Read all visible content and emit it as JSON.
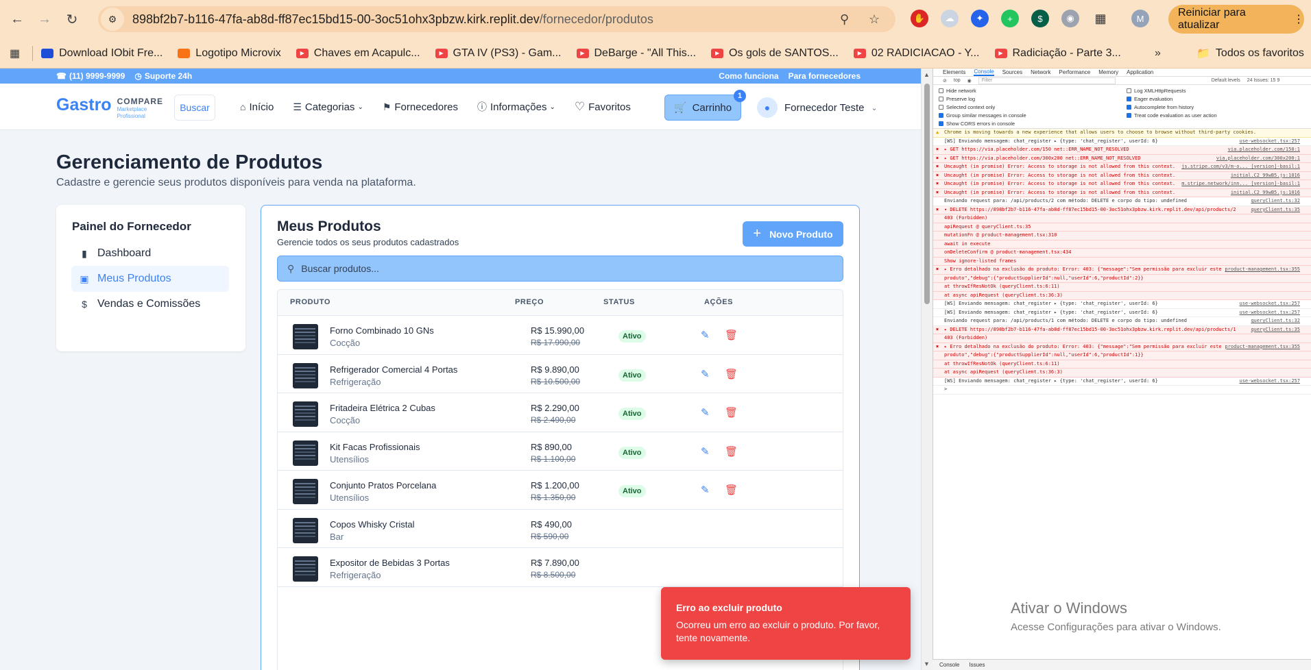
{
  "browser": {
    "url_host": "898bf2b7-b116-47fa-ab8d-ff87ec15bd15-00-3oc51ohx3pbzw.kirk.replit.dev",
    "url_path": "/fornecedor/produtos",
    "update_button": "Reiniciar para atualizar",
    "profile_initial": "M",
    "bookmarks": [
      {
        "label": "Download IObit Fre...",
        "color": "#1d4ed8"
      },
      {
        "label": "Logotipo Microvix",
        "color": "#f97316"
      },
      {
        "label": "Chaves em Acapulc...",
        "color": "#ef4444"
      },
      {
        "label": "GTA IV (PS3) - Gam...",
        "color": "#ef4444"
      },
      {
        "label": "DeBarge - \"All This...",
        "color": "#ef4444"
      },
      {
        "label": "Os gols de SANTOS...",
        "color": "#ef4444"
      },
      {
        "label": "02 RADICIACAO - Y...",
        "color": "#ef4444"
      },
      {
        "label": "Radiciação - Parte 3...",
        "color": "#ef4444"
      }
    ],
    "all_favorites": "Todos os favoritos"
  },
  "topbar": {
    "phone": "(11) 9999-9999",
    "support": "Suporte 24h",
    "how_it_works": "Como funciona",
    "for_suppliers": "Para fornecedores"
  },
  "header": {
    "logo_main": "Gastro",
    "logo_compare": "COMPARE",
    "logo_tag1": "Marketplace",
    "logo_tag2": "Profissional",
    "search_label": "Buscar",
    "nav": {
      "home": "Início",
      "categories": "Categorias",
      "suppliers": "Fornecedores",
      "info": "Informações",
      "favorites": "Favoritos"
    },
    "cart_label": "Carrinho",
    "cart_count": "1",
    "user_name": "Fornecedor Teste"
  },
  "page": {
    "title": "Gerenciamento de Produtos",
    "subtitle": "Cadastre e gerencie seus produtos disponíveis para venda na plataforma."
  },
  "sidebar": {
    "title": "Painel do Fornecedor",
    "items": [
      {
        "label": "Dashboard",
        "icon": "bar-chart-icon"
      },
      {
        "label": "Meus Produtos",
        "icon": "package-icon",
        "active": true
      },
      {
        "label": "Vendas e Comissões",
        "icon": "dollar-icon"
      }
    ]
  },
  "products_card": {
    "title": "Meus Produtos",
    "subtitle": "Gerencie todos os seus produtos cadastrados",
    "new_button": "Novo Produto",
    "search_placeholder": "Buscar produtos...",
    "columns": {
      "product": "PRODUTO",
      "price": "PREÇO",
      "status": "STATUS",
      "actions": "AÇÕES"
    },
    "rows": [
      {
        "name": "Forno Combinado 10 GNs",
        "category": "Cocção",
        "price": "R$ 15.990,00",
        "old_price": "R$ 17.990,00",
        "status": "Ativo"
      },
      {
        "name": "Refrigerador Comercial 4 Portas",
        "category": "Refrigeração",
        "price": "R$ 9.890,00",
        "old_price": "R$ 10.500,00",
        "status": "Ativo"
      },
      {
        "name": "Fritadeira Elétrica 2 Cubas",
        "category": "Cocção",
        "price": "R$ 2.290,00",
        "old_price": "R$ 2.490,00",
        "status": "Ativo"
      },
      {
        "name": "Kit Facas Profissionais",
        "category": "Utensílios",
        "price": "R$ 890,00",
        "old_price": "R$ 1.100,00",
        "status": "Ativo"
      },
      {
        "name": "Conjunto Pratos Porcelana",
        "category": "Utensílios",
        "price": "R$ 1.200,00",
        "old_price": "R$ 1.350,00",
        "status": "Ativo"
      },
      {
        "name": "Copos Whisky Cristal",
        "category": "Bar",
        "price": "R$ 490,00",
        "old_price": "R$ 590,00",
        "status": ""
      },
      {
        "name": "Expositor de Bebidas 3 Portas",
        "category": "Refrigeração",
        "price": "R$ 7.890,00",
        "old_price": "R$ 8.500,00",
        "status": ""
      }
    ]
  },
  "toast": {
    "title": "Erro ao excluir produto",
    "message": "Ocorreu um erro ao excluir o produto. Por favor, tente novamente."
  },
  "devtools": {
    "tabs": [
      "Elements",
      "Console",
      "Sources",
      "Network",
      "Performance",
      "Memory",
      "Application"
    ],
    "active_tab": "Console",
    "context": "top",
    "filter_placeholder": "Filter",
    "levels": "Default levels",
    "issues": "24 Issues: 15 9",
    "settings_left": [
      "Hide network",
      "Preserve log",
      "Selected context only",
      "Group similar messages in console",
      "Show CORS errors in console"
    ],
    "settings_right": [
      "Log XMLHttpRequests",
      "Eager evaluation",
      "Autocomplete from history",
      "Treat code evaluation as user action"
    ],
    "logs": [
      {
        "type": "warn",
        "text": "Chrome is moving towards a new experience that allows users to choose to browse without third-party cookies.",
        "src": ""
      },
      {
        "type": "info",
        "text": "[WS] Enviando mensagem: chat_register ▸ {type: 'chat_register', userId: 6}",
        "src": "use-websocket.tsx:257"
      },
      {
        "type": "err",
        "text": "▸ GET https://via.placeholder.com/150 net::ERR_NAME_NOT_RESOLVED",
        "src": "via.placeholder.com/150:1"
      },
      {
        "type": "err",
        "text": "▸ GET https://via.placeholder.com/300x200 net::ERR_NAME_NOT_RESOLVED",
        "src": "via.placeholder.com/300x200:1"
      },
      {
        "type": "err",
        "text": "Uncaught (in promise) Error: Access to storage is not allowed from this context.",
        "src": "js.stripe.com/v3/m-o..._[version]-basil:1"
      },
      {
        "type": "err",
        "text": "Uncaught (in promise) Error: Access to storage is not allowed from this context.",
        "src": "initial.C2_99wB5.js:1016"
      },
      {
        "type": "err",
        "text": "Uncaught (in promise) Error: Access to storage is not allowed from this context.",
        "src": "m.stripe.network/inn..._[version]-basil:1"
      },
      {
        "type": "err",
        "text": "Uncaught (in promise) Error: Access to storage is not allowed from this context.",
        "src": "initial.C2_99wB5.js:1016"
      },
      {
        "type": "info",
        "text": "Enviando request para: /api/products/2 com método: DELETE e corpo do tipo: undefined",
        "src": "queryClient.ts:32"
      },
      {
        "type": "err",
        "text": "▾ DELETE https://898bf2b7-b116-47fa-ab8d-ff87ec15bd15-00-3oc51ohx3pbzw.kirk.replit.dev/api/products/2",
        "src": "queryClient.ts:35"
      },
      {
        "type": "err",
        "text": "403 (Forbidden)",
        "src": ""
      },
      {
        "type": "err",
        "text": "  apiRequest      @ queryClient.ts:35",
        "src": ""
      },
      {
        "type": "err",
        "text": "  mutationFn      @ product-management.tsx:310",
        "src": ""
      },
      {
        "type": "err",
        "text": "  await in execute",
        "src": ""
      },
      {
        "type": "err",
        "text": "  onDeleteConfirm @ product-management.tsx:434",
        "src": ""
      },
      {
        "type": "err",
        "text": "  Show ignore-listed frames",
        "src": ""
      },
      {
        "type": "err",
        "text": "▸ Erro detalhado na exclusão do produto: Error: 403: {\"message\":\"Sem permissão para excluir este",
        "src": "product-management.tsx:355"
      },
      {
        "type": "err",
        "text": "produto\",\"debug\":{\"productSupplierId\":null,\"userId\":6,\"productId\":2}}",
        "src": ""
      },
      {
        "type": "err",
        "text": "    at throwIfResNotOk (queryClient.ts:6:11)",
        "src": ""
      },
      {
        "type": "err",
        "text": "    at async apiRequest (queryClient.ts:36:3)",
        "src": ""
      },
      {
        "type": "info",
        "text": "[WS] Enviando mensagem: chat_register ▸ {type: 'chat_register', userId: 6}",
        "src": "use-websocket.tsx:257"
      },
      {
        "type": "info",
        "text": "[WS] Enviando mensagem: chat_register ▸ {type: 'chat_register', userId: 6}",
        "src": "use-websocket.tsx:257"
      },
      {
        "type": "info",
        "text": "Enviando request para: /api/products/1 com método: DELETE e corpo do tipo: undefined",
        "src": "queryClient.ts:32"
      },
      {
        "type": "err",
        "text": "▸ DELETE https://898bf2b7-b116-47fa-ab8d-ff87ec15bd15-00-3oc51ohx3pbzw.kirk.replit.dev/api/products/1",
        "src": "queryClient.ts:35"
      },
      {
        "type": "err",
        "text": "403 (Forbidden)",
        "src": ""
      },
      {
        "type": "err",
        "text": "▸ Erro detalhado na exclusão do produto: Error: 403: {\"message\":\"Sem permissão para excluir este",
        "src": "product-management.tsx:355"
      },
      {
        "type": "err",
        "text": "produto\",\"debug\":{\"productSupplierId\":null,\"userId\":6,\"productId\":1}}",
        "src": ""
      },
      {
        "type": "err",
        "text": "    at throwIfResNotOk (queryClient.ts:6:11)",
        "src": ""
      },
      {
        "type": "err",
        "text": "    at async apiRequest (queryClient.ts:36:3)",
        "src": ""
      },
      {
        "type": "info",
        "text": "[WS] Enviando mensagem: chat_register ▸ {type: 'chat_register', userId: 6}",
        "src": "use-websocket.tsx:257"
      },
      {
        "type": "info",
        "text": ">",
        "src": ""
      }
    ],
    "bottom_tabs": [
      "Console",
      "Issues"
    ]
  },
  "windows": {
    "activate_title": "Ativar o Windows",
    "activate_sub": "Acesse Configurações para ativar o Windows."
  }
}
